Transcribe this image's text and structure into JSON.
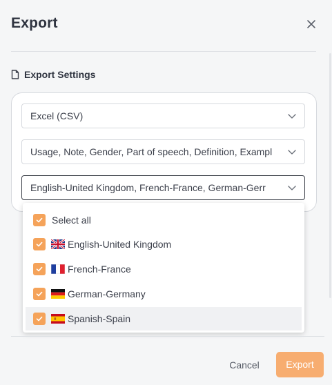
{
  "dialog": {
    "title": "Export",
    "close_icon": "close-icon"
  },
  "section": {
    "icon": "document-icon",
    "label": "Export Settings"
  },
  "selects": {
    "format": "Excel (CSV)",
    "fields": "Usage, Note, Gender, Part of speech, Definition, Exampl",
    "languages": "English-United Kingdom, French-France, German-Gerr"
  },
  "dropdown": {
    "select_all": "Select all",
    "options": [
      {
        "label": "English-United Kingdom",
        "flag": "uk-flag-icon",
        "checked": true
      },
      {
        "label": "French-France",
        "flag": "france-flag-icon",
        "checked": true
      },
      {
        "label": "German-Germany",
        "flag": "germany-flag-icon",
        "checked": true
      },
      {
        "label": "Spanish-Spain",
        "flag": "spain-flag-icon",
        "checked": true
      }
    ]
  },
  "footer": {
    "cancel_label": "Cancel",
    "export_label": "Export"
  },
  "colors": {
    "accent": "#f5a35a",
    "export_button": "#f7ad70",
    "background": "#f5f6f7"
  }
}
